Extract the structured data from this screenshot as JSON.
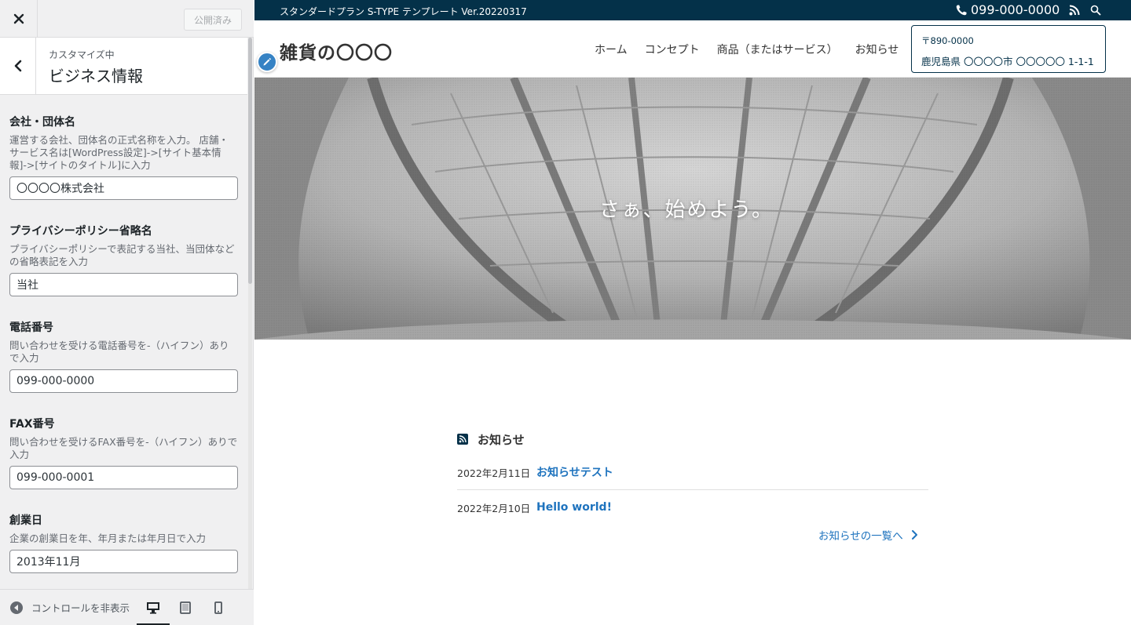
{
  "customizer": {
    "publish_label": "公開済み",
    "section_sub": "カスタマイズ中",
    "section_title": "ビジネス情報",
    "controls": [
      {
        "label": "会社・団体名",
        "desc": "運営する会社、団体名の正式名称を入力。 店舗・サービス名は[WordPress設定]->[サイト基本情報]->[サイトのタイトル]に入力",
        "value": "〇〇〇〇株式会社"
      },
      {
        "label": "プライバシーポリシー省略名",
        "desc": "プライバシーポリシーで表記する当社、当団体などの省略表記を入力",
        "value": "当社"
      },
      {
        "label": "電話番号",
        "desc": "問い合わせを受ける電話番号を-（ハイフン）ありで入力",
        "value": "099-000-0000"
      },
      {
        "label": "FAX番号",
        "desc": "問い合わせを受けるFAX番号を-（ハイフン）ありで入力",
        "value": "099-000-0001"
      },
      {
        "label": "創業日",
        "desc": "企業の創業日を年、年月または年月日で入力",
        "value": "2013年11月"
      }
    ],
    "collapse_label": "コントロールを非表示",
    "icons": {
      "close": "close-icon",
      "back": "chevron-left-icon",
      "collapse": "arrow-left-circle-icon",
      "desktop": "desktop-icon",
      "tablet": "tablet-icon",
      "mobile": "mobile-icon"
    }
  },
  "site": {
    "tagline": "スタンダードプラン S-TYPE テンプレート Ver.20220317",
    "phone": "099-000-0000",
    "logo": "雑貨の〇〇〇",
    "nav": [
      "ホーム",
      "コンセプト",
      "商品（またはサービス）",
      "お知らせ"
    ],
    "address_zip": "〒890-0000",
    "address_line": "鹿児島県 〇〇〇〇市 〇〇〇〇〇 1-1-1",
    "hero_copy": "さぁ、始めよう。",
    "colors": {
      "brand": "#043149",
      "link": "#1e73be",
      "edit": "#3582c4"
    }
  },
  "news": {
    "title": "お知らせ",
    "items": [
      {
        "date": "2022年2月11日",
        "title": "お知らせテスト"
      },
      {
        "date": "2022年2月10日",
        "title": "Hello world!"
      }
    ],
    "more_label": "お知らせの一覧へ"
  }
}
